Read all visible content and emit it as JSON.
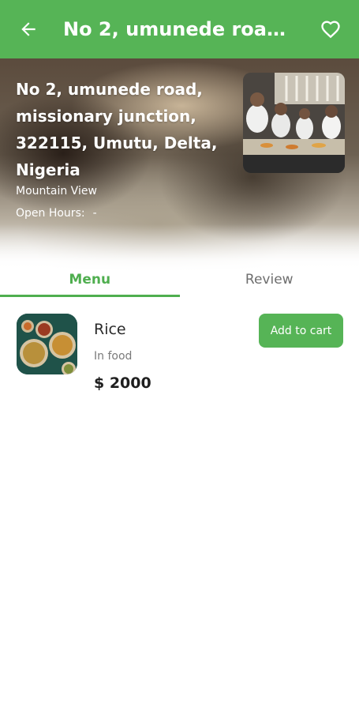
{
  "colors": {
    "accent": "#56b456",
    "tab_active": "#4fae4f",
    "text_primary": "#2a2a2a",
    "text_secondary": "#7a7a7a"
  },
  "appbar": {
    "title": "No 2, umunede road, ...",
    "back_icon": "arrow-left-icon",
    "favorite_icon": "heart-outline-icon"
  },
  "restaurant": {
    "address": "No 2, umunede road, missionary junction, 322115, Umutu, Delta, Nigeria",
    "city": "Mountain View",
    "open_hours_label": "Open Hours:",
    "open_hours_value": "-"
  },
  "tabs": [
    {
      "label": "Menu",
      "active": true
    },
    {
      "label": "Review",
      "active": false
    }
  ],
  "menu": {
    "items": [
      {
        "name": "Rice",
        "category": "In food",
        "price": "$ 2000",
        "cta": "Add to cart"
      }
    ]
  }
}
